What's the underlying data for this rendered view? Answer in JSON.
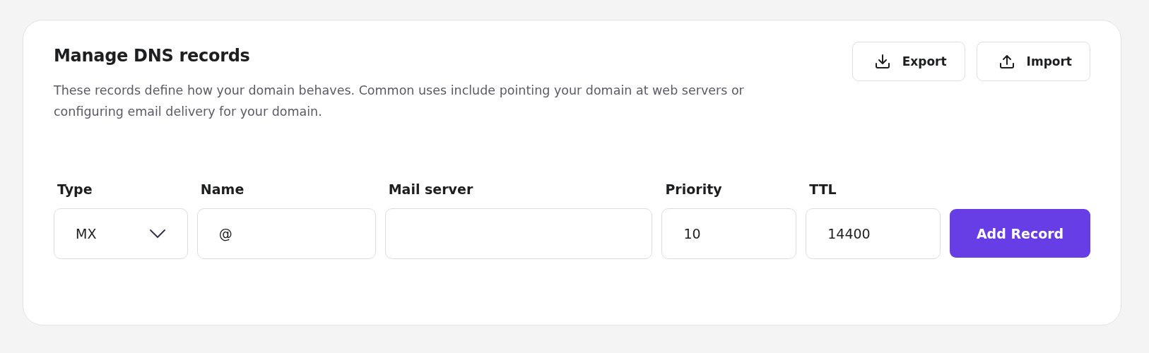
{
  "title": "Manage DNS records",
  "description": "These records define how your domain behaves. Common uses include pointing your domain at web servers or configuring email delivery for your domain.",
  "actions": [
    {
      "label": "Export",
      "kind": "download"
    },
    {
      "label": "Import",
      "kind": "upload"
    }
  ],
  "fields": [
    {
      "label": "Type",
      "kind": "select",
      "value": "MX"
    },
    {
      "label": "Name",
      "kind": "text",
      "value": "@"
    },
    {
      "label": "Mail server",
      "kind": "text"
    },
    {
      "label": "Priority",
      "kind": "text",
      "value": "10"
    },
    {
      "label": "TTL",
      "kind": "text",
      "value": "14400"
    }
  ],
  "submit": "Add Record"
}
